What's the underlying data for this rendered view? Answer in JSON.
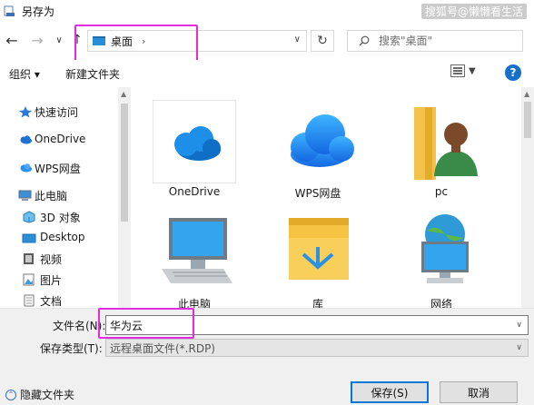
{
  "window": {
    "title": "另存为",
    "watermark": "搜狐号@懒懒看生活"
  },
  "nav": {
    "back_icon": "arrow-left-icon",
    "forward_icon": "arrow-right-icon",
    "recent_icon": "chevron-down-icon",
    "address_crumb": "桌面",
    "refresh_icon": "refresh-icon",
    "search_placeholder": "搜索\"桌面\""
  },
  "toolbar": {
    "organize_label": "组织 ▾",
    "new_folder_label": "新建文件夹"
  },
  "sidebar": {
    "items": [
      {
        "label": "快速访问",
        "icon": "star-pin-icon"
      },
      {
        "label": "OneDrive",
        "icon": "onedrive-cloud-icon"
      },
      {
        "label": "WPS网盘",
        "icon": "wps-cloud-icon"
      },
      {
        "label": "此电脑",
        "icon": "computer-icon"
      },
      {
        "label": "3D 对象",
        "icon": "cube-3d-icon"
      },
      {
        "label": "Desktop",
        "icon": "desktop-folder-icon"
      },
      {
        "label": "视频",
        "icon": "video-icon"
      },
      {
        "label": "图片",
        "icon": "picture-icon"
      },
      {
        "label": "文档",
        "icon": "document-icon"
      }
    ]
  },
  "content": {
    "items": [
      {
        "label": "OneDrive",
        "icon": "onedrive-cloud-icon"
      },
      {
        "label": "WPS网盘",
        "icon": "wps-cloud-icon"
      },
      {
        "label": "pc",
        "icon": "user-folder-icon"
      },
      {
        "label": "此电脑",
        "icon": "computer-icon"
      },
      {
        "label": "库",
        "icon": "library-folder-icon"
      },
      {
        "label": "网络",
        "icon": "network-icon"
      }
    ]
  },
  "form": {
    "filename_label": "文件名(N):",
    "filename_value": "华为云",
    "filetype_label": "保存类型(T):",
    "filetype_value": "远程桌面文件(*.RDP)"
  },
  "footer": {
    "hide_folders_label": "隐藏文件夹",
    "save_label": "保存(S)",
    "cancel_label": "取消"
  },
  "colors": {
    "accent": "#0078d7",
    "highlight": "#e22ce0",
    "folder": "#f5c242",
    "cloud_blue": "#1e90e8"
  }
}
